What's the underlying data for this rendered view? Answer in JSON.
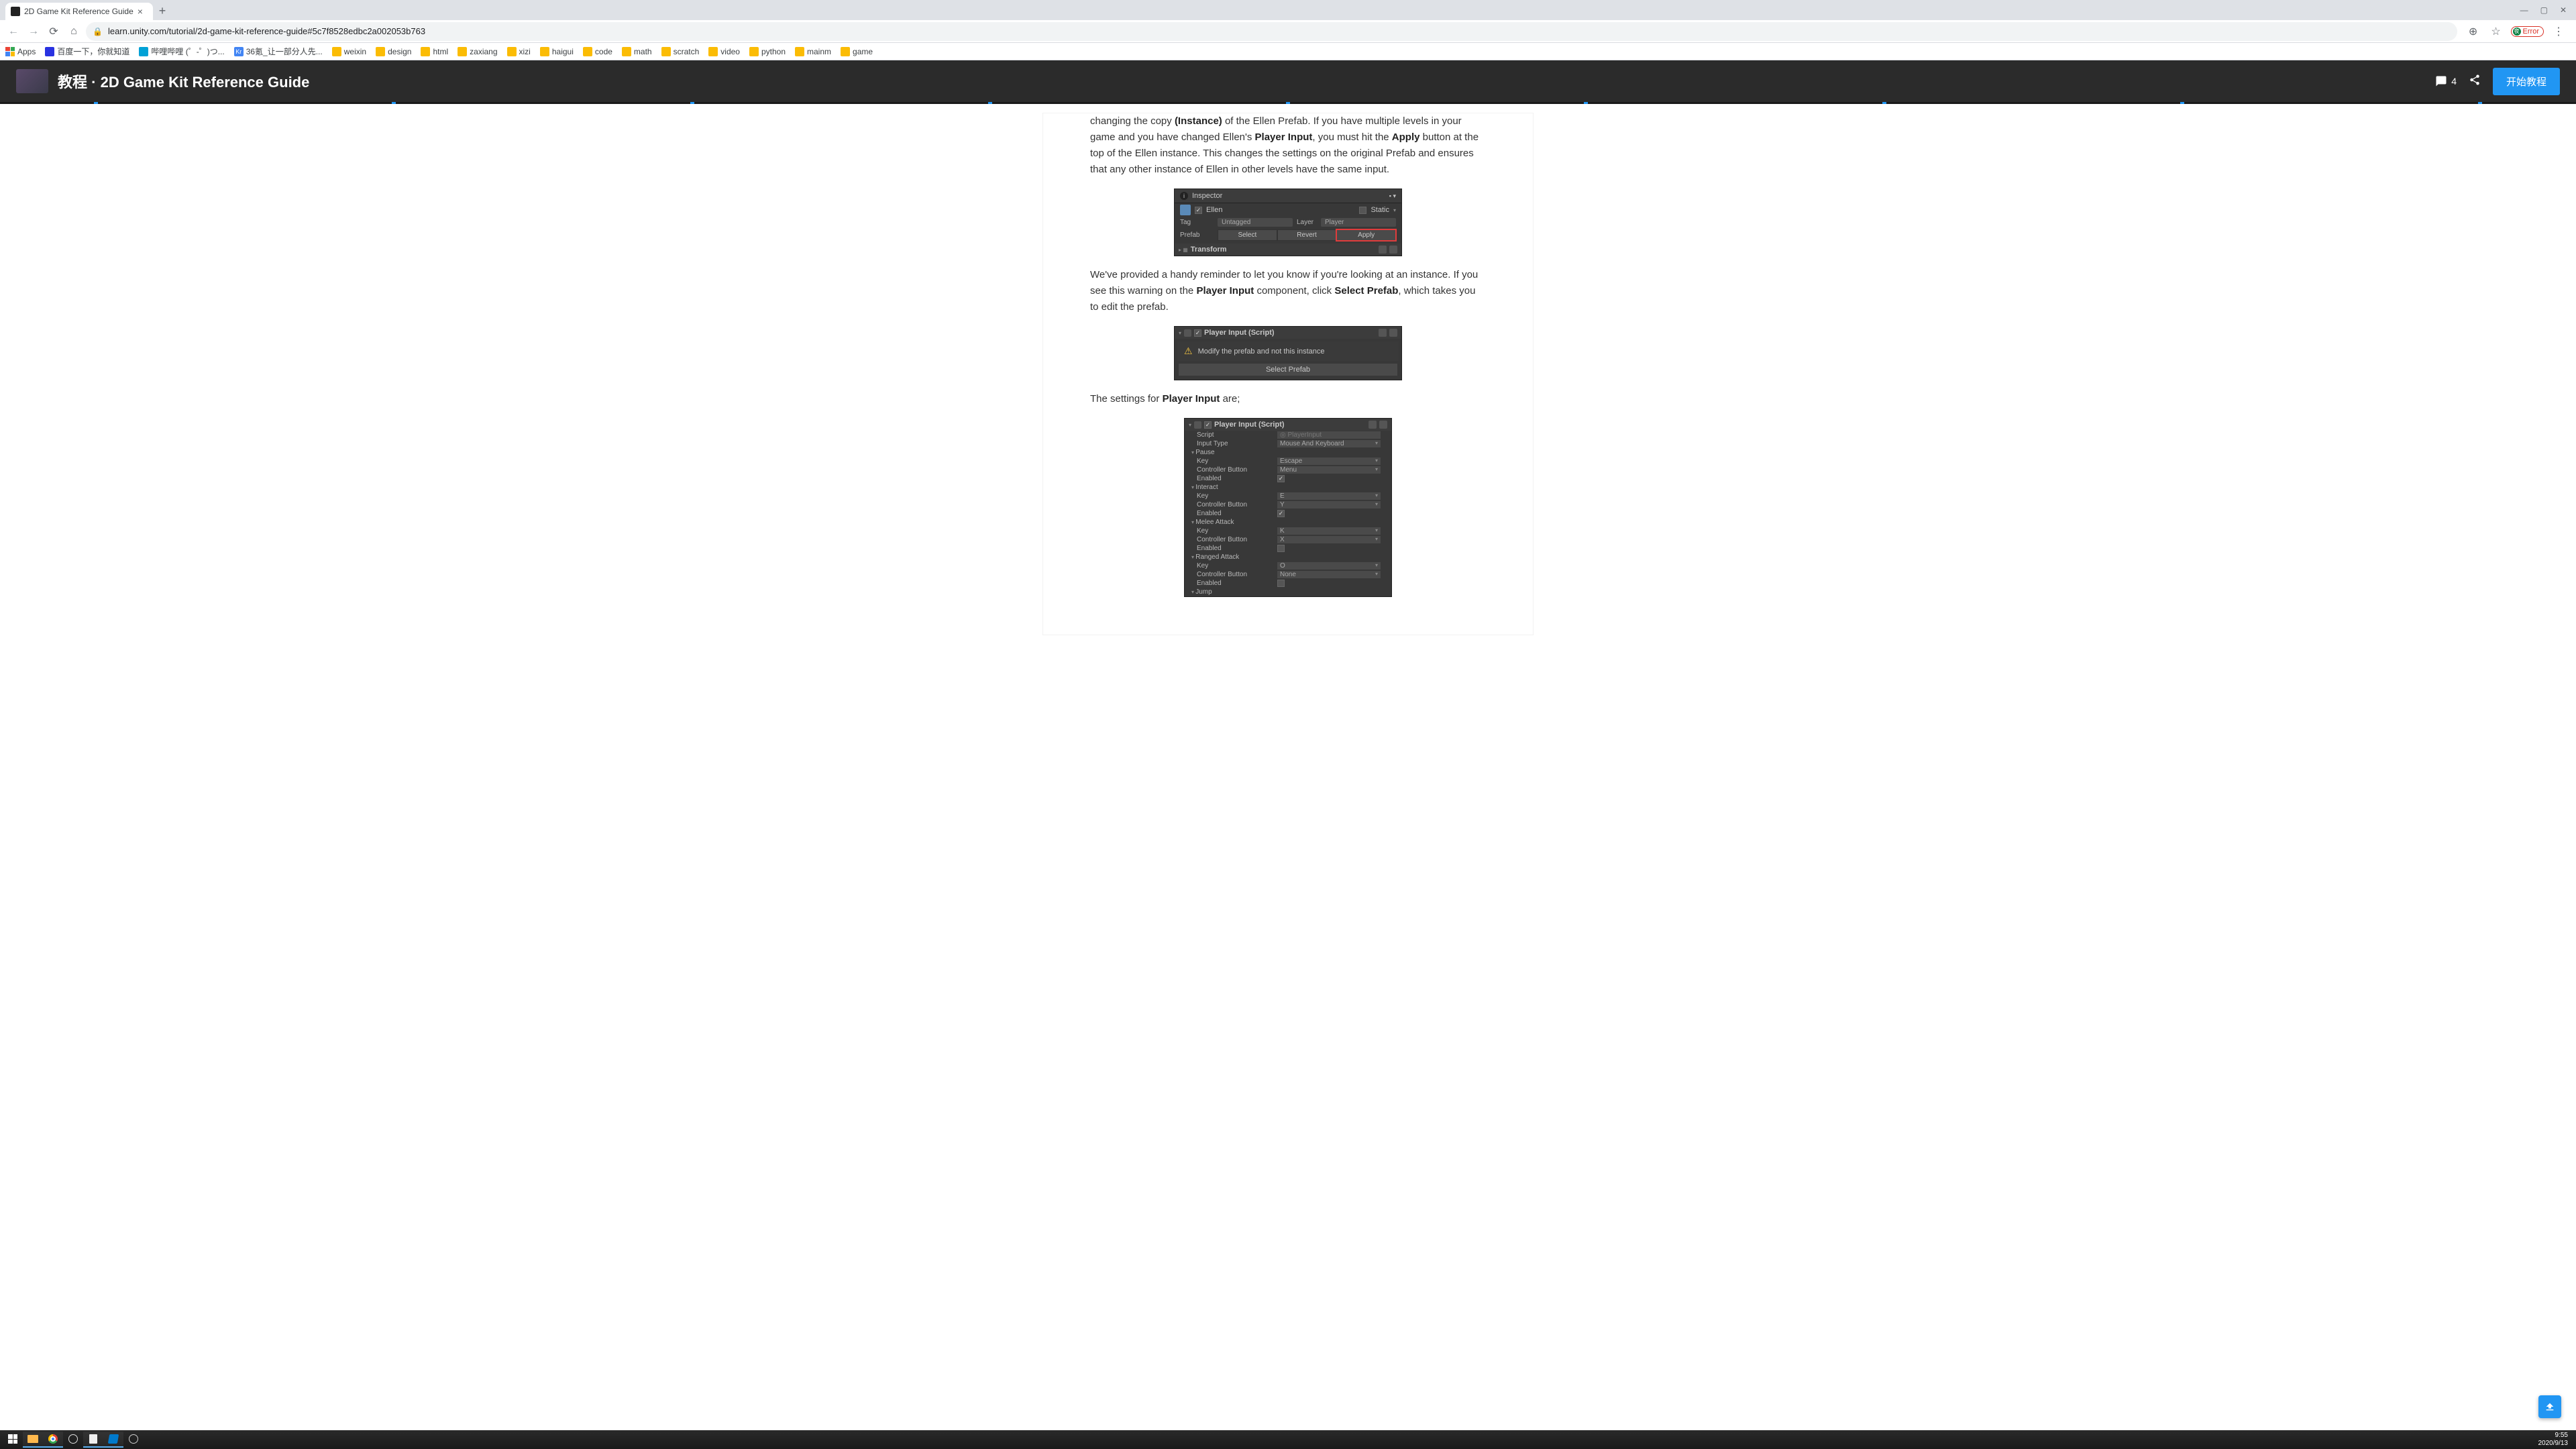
{
  "browser": {
    "tab_title": "2D Game Kit Reference Guide",
    "url": "learn.unity.com/tutorial/2d-game-kit-reference-guide#5c7f8528edbc2a002053b763",
    "error_label": "Error",
    "bookmarks": [
      {
        "label": "Apps",
        "icon": "apps"
      },
      {
        "label": "百度一下，你就知道",
        "icon": "baidu"
      },
      {
        "label": "哔哩哔哩 (゜-゜)つ...",
        "icon": "bili"
      },
      {
        "label": "36氪_让一部分人先...",
        "icon": "kr"
      },
      {
        "label": "weixin",
        "icon": "folder"
      },
      {
        "label": "design",
        "icon": "folder"
      },
      {
        "label": "html",
        "icon": "folder"
      },
      {
        "label": "zaxiang",
        "icon": "folder"
      },
      {
        "label": "xizi",
        "icon": "folder"
      },
      {
        "label": "haigui",
        "icon": "folder"
      },
      {
        "label": "code",
        "icon": "folder"
      },
      {
        "label": "math",
        "icon": "folder"
      },
      {
        "label": "scratch",
        "icon": "folder"
      },
      {
        "label": "video",
        "icon": "folder"
      },
      {
        "label": "python",
        "icon": "folder"
      },
      {
        "label": "mainm",
        "icon": "folder"
      },
      {
        "label": "game",
        "icon": "folder"
      }
    ]
  },
  "header": {
    "breadcrumb": "教程",
    "title": "2D Game Kit Reference Guide",
    "comment_count": "4",
    "start_button": "开始教程"
  },
  "article": {
    "p1_a": "changing the copy ",
    "p1_b": "(Instance)",
    "p1_c": " of the Ellen Prefab. If you have multiple levels in your game and you have changed Ellen's ",
    "p1_d": "Player Input",
    "p1_e": ", you must hit the ",
    "p1_f": "Apply",
    "p1_g": " button at the top of the Ellen instance. This changes the settings on the original Prefab and ensures that any other instance of Ellen in other levels have the same input.",
    "p2_a": "We've provided a handy reminder to let you know if you're looking at an instance. If you see this warning on the ",
    "p2_b": "Player Input",
    "p2_c": " component, click ",
    "p2_d": "Select Prefab",
    "p2_e": ", which takes you to edit the prefab.",
    "p3_a": "The settings for ",
    "p3_b": "Player Input",
    "p3_c": " are;"
  },
  "inspector1": {
    "header": "Inspector",
    "name": "Ellen",
    "static": "Static",
    "tag_label": "Tag",
    "tag_value": "Untagged",
    "layer_label": "Layer",
    "layer_value": "Player",
    "prefab_label": "Prefab",
    "select": "Select",
    "revert": "Revert",
    "apply": "Apply",
    "transform": "Transform"
  },
  "inspector2": {
    "title": "Player Input (Script)",
    "warning": "Modify the prefab and not this instance",
    "button": "Select Prefab"
  },
  "inspector3": {
    "title": "Player Input (Script)",
    "script_label": "Script",
    "script_value": "PlayerInput",
    "inputtype_label": "Input Type",
    "inputtype_value": "Mouse And Keyboard",
    "groups": [
      {
        "name": "Pause",
        "key": "Escape",
        "controller": "Menu",
        "enabled": true
      },
      {
        "name": "Interact",
        "key": "E",
        "controller": "Y",
        "enabled": true
      },
      {
        "name": "Melee Attack",
        "key": "K",
        "controller": "X",
        "enabled": false
      },
      {
        "name": "Ranged Attack",
        "key": "O",
        "controller": "None",
        "enabled": false
      }
    ],
    "jump": "Jump",
    "labels": {
      "key": "Key",
      "controller": "Controller Button",
      "enabled": "Enabled"
    }
  },
  "taskbar": {
    "time": "9:55",
    "date": "2020/9/13"
  }
}
